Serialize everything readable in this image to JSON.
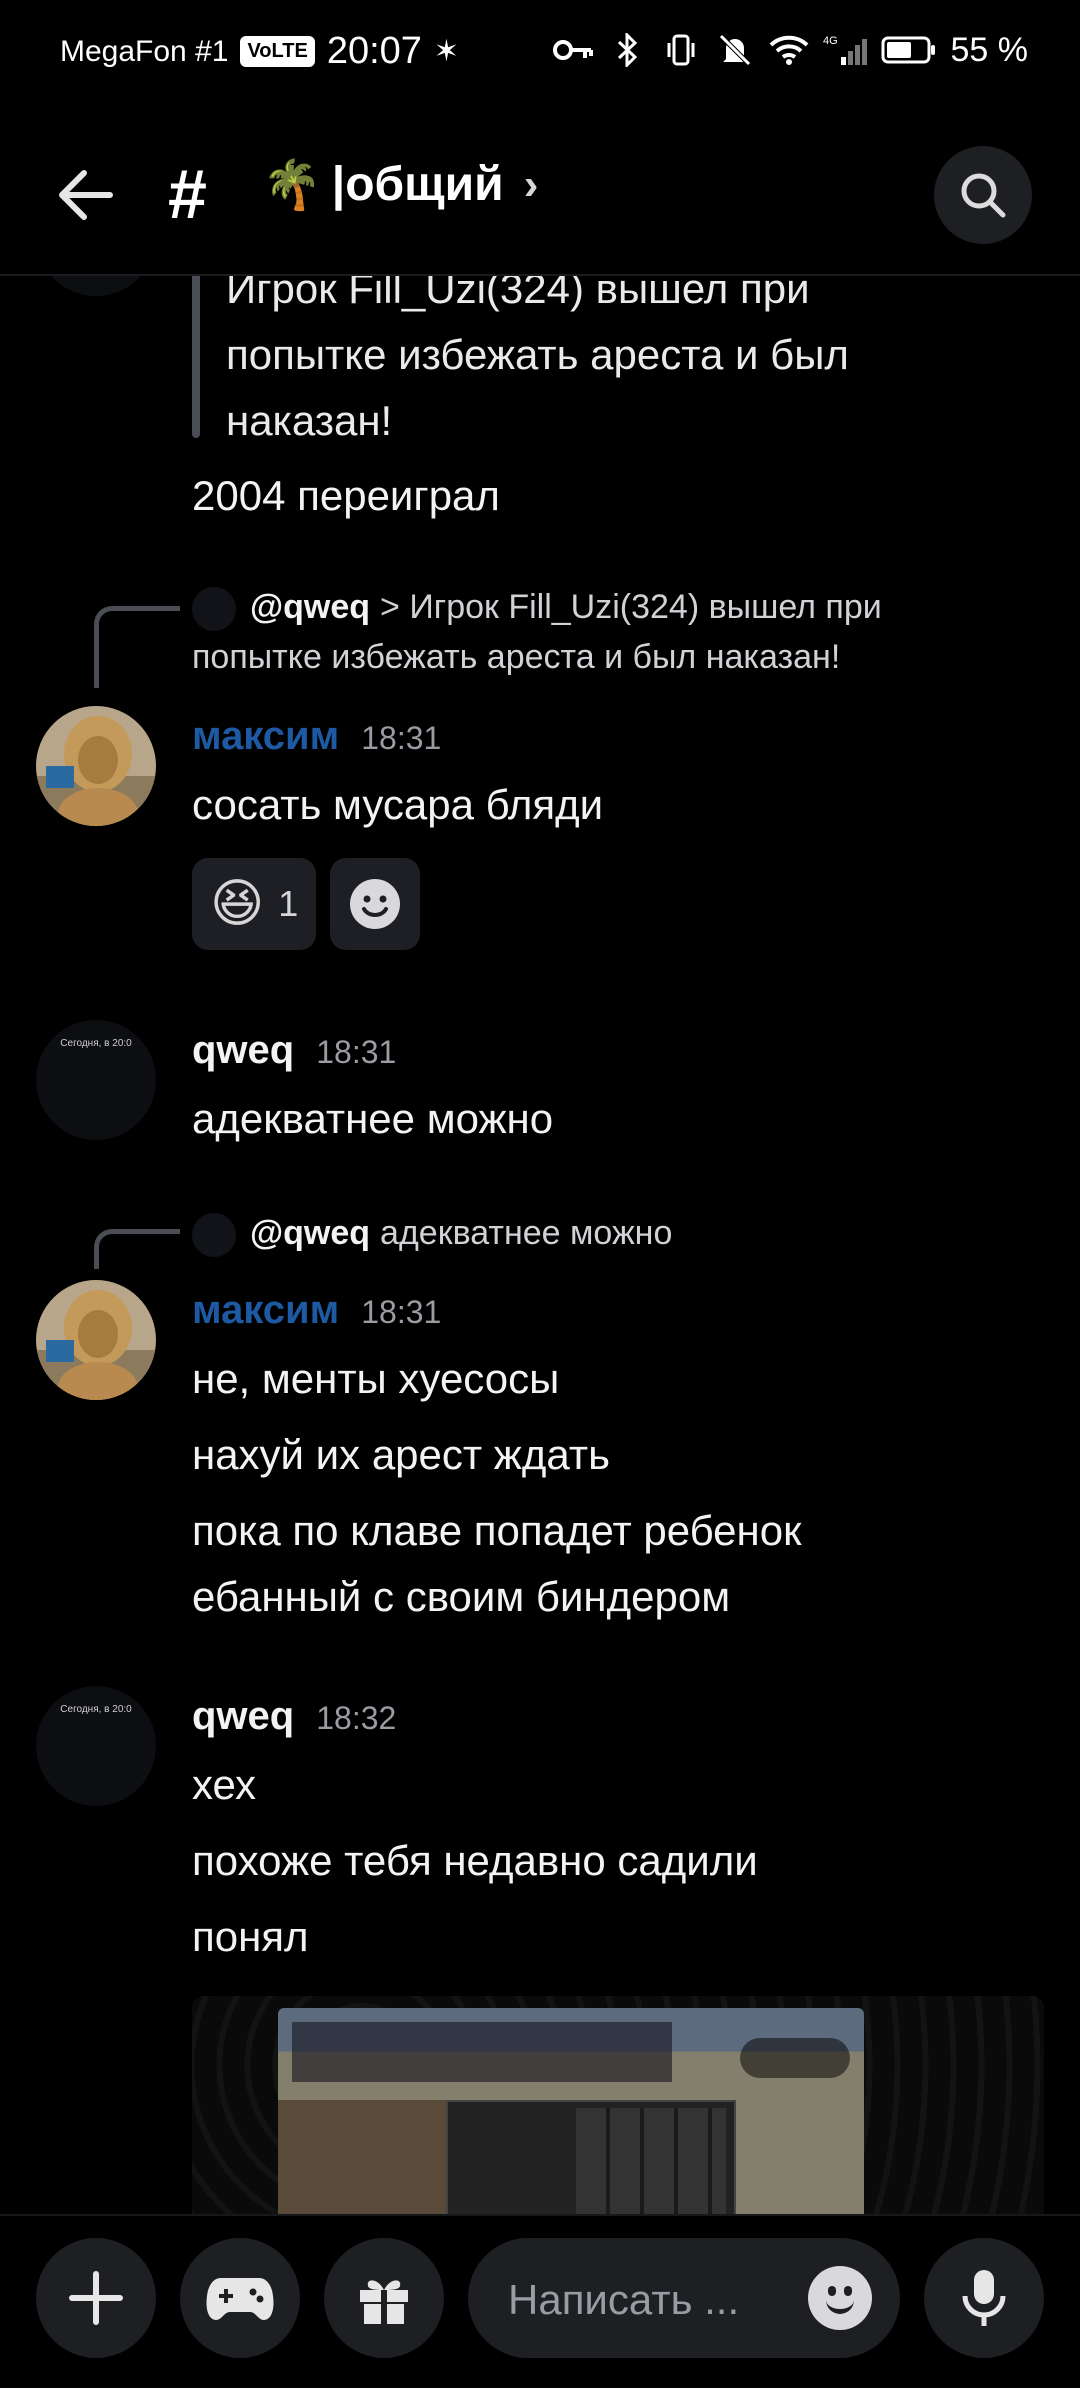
{
  "status_bar": {
    "carrier": "MegaFon #1",
    "volte": "VoLTE",
    "time": "20:07",
    "battery": "55 %",
    "network": "4G",
    "icons": [
      "key-icon",
      "bluetooth-icon",
      "vibrate-icon",
      "mute-icon",
      "wifi-icon",
      "signal-icon",
      "battery-icon"
    ]
  },
  "header": {
    "hash": "#",
    "emoji": "🌴",
    "title": "|общий",
    "chevron": "›"
  },
  "messages": {
    "quoted_block": "Игрок Fill_Uzi(324) вышел при попытке избежать ареста и был наказан!",
    "quoted_line1": "Игрок Fill_Uzi(324) вышел при",
    "quoted_line2": "попытке избежать ареста и был",
    "quoted_line3": "наказан!",
    "msg_2004": "2004 переиграл",
    "reply1": {
      "author": "@qweq",
      "text_line1": "> Игрок Fill_Uzi(324) вышел при",
      "text_line2": "попытке избежать ареста и был наказан!"
    },
    "maxim1": {
      "name": "максим",
      "time": "18:31",
      "text": "сосать мусара бляди",
      "reaction_emoji": "😆",
      "reaction_count": "1"
    },
    "qweq1": {
      "name": "qweq",
      "time": "18:31",
      "avatar_caption": "Сегодня, в 20:0",
      "text": "адекватнее можно"
    },
    "reply2": {
      "author": "@qweq",
      "text": "адекватнее можно"
    },
    "maxim2": {
      "name": "максим",
      "time": "18:31",
      "line1": "не, менты хуесосы",
      "line2": "нахуй их арест ждать",
      "line3": "пока по клаве попадет ребенок",
      "line4": "ебанный с своим биндером"
    },
    "qweq2": {
      "name": "qweq",
      "time": "18:32",
      "avatar_caption": "Сегодня, в 20:0",
      "line1": "хех",
      "line2": "похоже тебя недавно садили",
      "line3": "понял"
    }
  },
  "composer": {
    "placeholder": "Написать ..."
  },
  "colors": {
    "background": "#000000",
    "surface": "#1e1f22",
    "username_accent": "#1e5aa3",
    "muted_text": "#9b9ba3"
  }
}
